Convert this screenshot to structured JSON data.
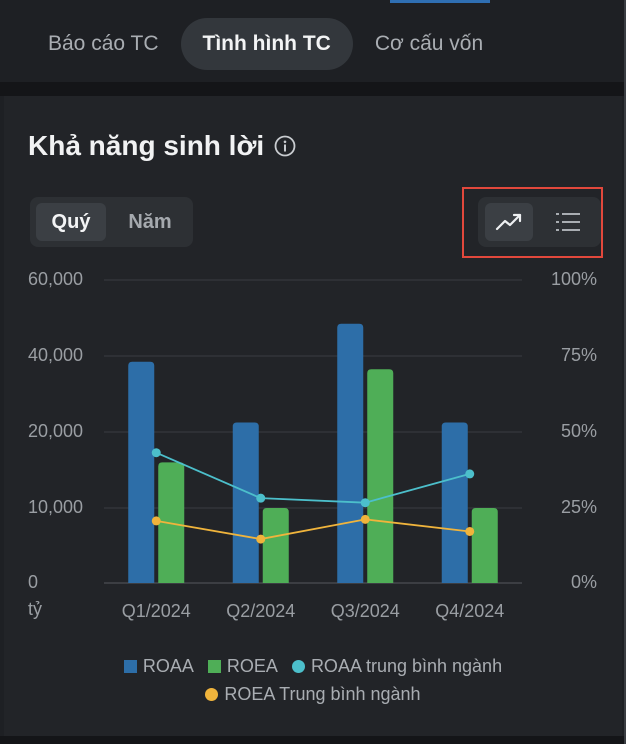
{
  "tabs": [
    {
      "label": "Báo cáo TC",
      "active": false
    },
    {
      "label": "Tình hình TC",
      "active": true
    },
    {
      "label": "Cơ cấu vốn",
      "active": false
    }
  ],
  "section": {
    "title": "Khả năng sinh lời",
    "info_icon": "info-circle-icon"
  },
  "period_toggle": {
    "options": [
      "Quý",
      "Năm"
    ],
    "selected": "Quý"
  },
  "view_toggle": {
    "options": [
      "chart-trend-icon",
      "list-icon"
    ],
    "selected": "chart-trend-icon"
  },
  "colors": {
    "roaa": "#2d6ea8",
    "roea": "#4fae57",
    "roaa_avg": "#4cbfcb",
    "roea_avg": "#f0b43c",
    "highlight": "#e2483c"
  },
  "chart_data": {
    "type": "bar",
    "categories": [
      "Q1/2024",
      "Q2/2024",
      "Q3/2024",
      "Q4/2024"
    ],
    "y_left": {
      "ticks": [
        "60,000",
        "40,000",
        "20,000",
        "10,000",
        "0"
      ],
      "unit": "tỷ",
      "range": [
        0,
        60000
      ]
    },
    "y_right": {
      "ticks": [
        "100%",
        "75%",
        "50%",
        "25%",
        "0%"
      ],
      "range": [
        0,
        100
      ]
    },
    "series": [
      {
        "name": "ROAA",
        "kind": "bar",
        "axis": "left",
        "values": [
          38500,
          22500,
          48500,
          22500
        ]
      },
      {
        "name": "ROEA",
        "kind": "bar",
        "axis": "left",
        "values": [
          16000,
          10000,
          36500,
          10000
        ]
      },
      {
        "name": "ROAA trung bình ngành",
        "kind": "line",
        "axis": "right",
        "values": [
          43,
          28,
          26.5,
          36
        ]
      },
      {
        "name": "ROEA Trung bình ngành",
        "kind": "line",
        "axis": "right",
        "values": [
          20.5,
          14.5,
          21,
          17
        ]
      }
    ],
    "grid": true,
    "legend_position": "bottom"
  }
}
